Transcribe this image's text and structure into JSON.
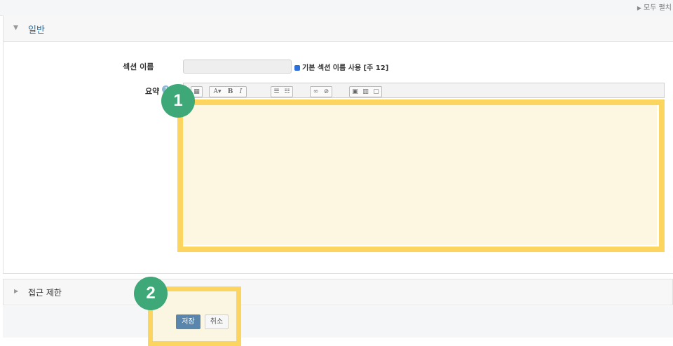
{
  "top": {
    "expand_all": "모두 펼치"
  },
  "section_general": {
    "title": "일반"
  },
  "form": {
    "section_name_label": "섹션 이름",
    "section_name_value": "",
    "use_default_label": "기본 섹션 이름 사용 [주 12]",
    "summary_label": "요약"
  },
  "toolbar": {
    "groups": [
      [
        "▦"
      ],
      [
        "A▾",
        "B",
        "I"
      ],
      [
        "☰",
        "☷"
      ],
      [
        "∞",
        "⊘"
      ],
      [
        "▣",
        "▥",
        "▢"
      ]
    ]
  },
  "section_access": {
    "title": "접근 제한"
  },
  "buttons": {
    "save": "저장",
    "cancel": "취소"
  },
  "annotations": {
    "badge1": "1",
    "badge2": "2"
  },
  "colors": {
    "highlight": "#fbd55f",
    "badge": "#3fa878",
    "primary_button": "#5a86ad",
    "section_link": "#1f6fb0"
  }
}
